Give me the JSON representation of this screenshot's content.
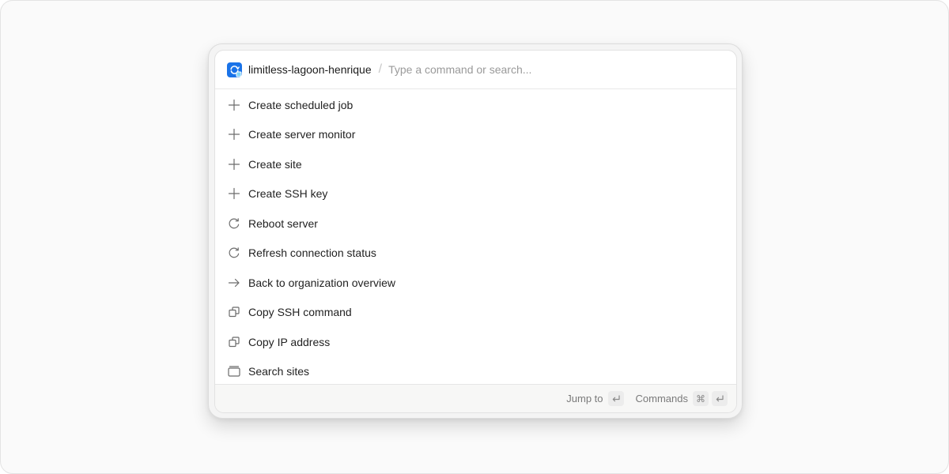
{
  "palette": {
    "server_name": "limitless-lagoon-henrique",
    "separator": "/",
    "search_placeholder": "Type a command or search...",
    "accent_color": "#1a73e8"
  },
  "items": [
    {
      "label": "Create scheduled job",
      "icon": "plus-icon"
    },
    {
      "label": "Create server monitor",
      "icon": "plus-icon"
    },
    {
      "label": "Create site",
      "icon": "plus-icon"
    },
    {
      "label": "Create SSH key",
      "icon": "plus-icon"
    },
    {
      "label": "Reboot server",
      "icon": "refresh-icon"
    },
    {
      "label": "Refresh connection status",
      "icon": "refresh-icon"
    },
    {
      "label": "Back to organization overview",
      "icon": "arrow-right-icon"
    },
    {
      "label": "Copy SSH command",
      "icon": "copy-icon"
    },
    {
      "label": "Copy IP address",
      "icon": "copy-icon"
    },
    {
      "label": "Search sites",
      "icon": "window-icon"
    }
  ],
  "footer": {
    "jump_label": "Jump to",
    "commands_label": "Commands",
    "cmd_key": "⌘"
  }
}
